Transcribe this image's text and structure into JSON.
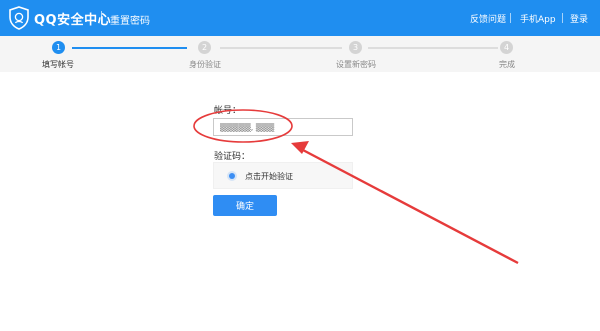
{
  "header": {
    "brand": "QQ安全中心",
    "page_title": "重置密码",
    "nav": [
      "反馈问题",
      "手机App",
      "登录"
    ]
  },
  "steps": [
    {
      "num": "1",
      "label": "填写帐号",
      "state": "active"
    },
    {
      "num": "2",
      "label": "身份验证",
      "state": "pending"
    },
    {
      "num": "3",
      "label": "设置新密码",
      "state": "pending"
    },
    {
      "num": "4",
      "label": "完成",
      "state": "pending"
    }
  ],
  "form": {
    "account_label": "帐号：",
    "account_value": "▒▒▒▒▒, ▒▒▒",
    "captcha_label": "验证码：",
    "captcha_prompt": "点击开始验证",
    "confirm_label": "确定"
  },
  "colors": {
    "header_bg": "#1f8ef0",
    "accent": "#2f8df3",
    "annotation": "#e63b3b"
  }
}
